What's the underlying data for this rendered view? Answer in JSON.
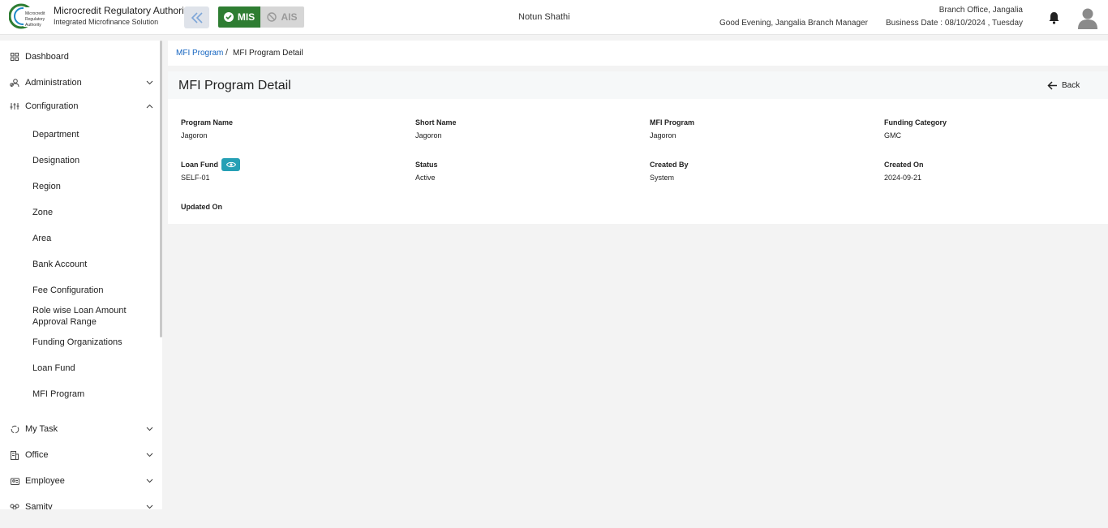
{
  "header": {
    "org_name": "Microcredit Regulatory Authority",
    "org_subtitle": "Integrated Microfinance Solution",
    "logo_text_line1": "Microcredit",
    "logo_text_line2": "Regulatory",
    "logo_text_line3": "Authority",
    "mis_label": "MIS",
    "ais_label": "AIS",
    "app_title": "Notun Shathi",
    "greeting": "Good Evening, Jangalia Branch Manager",
    "branch": "Branch Office, Jangalia",
    "business_date": "Business Date : 08/10/2024 , Tuesday",
    "accent_color": "#2e7d32"
  },
  "sidebar": {
    "items": [
      {
        "label": "Dashboard",
        "icon": "grid-icon"
      },
      {
        "label": "Administration",
        "icon": "users-icon"
      },
      {
        "label": "Configuration",
        "icon": "sliders-icon"
      },
      {
        "label": "My Task",
        "icon": "refresh-icon"
      },
      {
        "label": "Office",
        "icon": "building-icon"
      },
      {
        "label": "Employee",
        "icon": "employee-icon"
      },
      {
        "label": "Samity",
        "icon": "samity-icon"
      }
    ],
    "config_sub": [
      "Department",
      "Designation",
      "Region",
      "Zone",
      "Area",
      "Bank Account",
      "Fee Configuration",
      "Role wise Loan Amount Approval Range",
      "Funding Organizations",
      "Loan Fund",
      "MFI Program"
    ]
  },
  "breadcrumb": {
    "parent": "MFI Program",
    "separator": "/",
    "current": "MFI Program Detail"
  },
  "detail": {
    "title": "MFI Program Detail",
    "back_label": "Back",
    "fields": [
      {
        "label": "Program Name",
        "value": "Jagoron"
      },
      {
        "label": "Short Name",
        "value": "Jagoron"
      },
      {
        "label": "MFI Program",
        "value": "Jagoron"
      },
      {
        "label": "Funding Category",
        "value": "GMC"
      },
      {
        "label": "Loan Fund",
        "value": "SELF-01"
      },
      {
        "label": "Status",
        "value": "Active"
      },
      {
        "label": "Created By",
        "value": "System"
      },
      {
        "label": "Created On",
        "value": "2024-09-21"
      },
      {
        "label": "Updated On",
        "value": ""
      }
    ]
  }
}
